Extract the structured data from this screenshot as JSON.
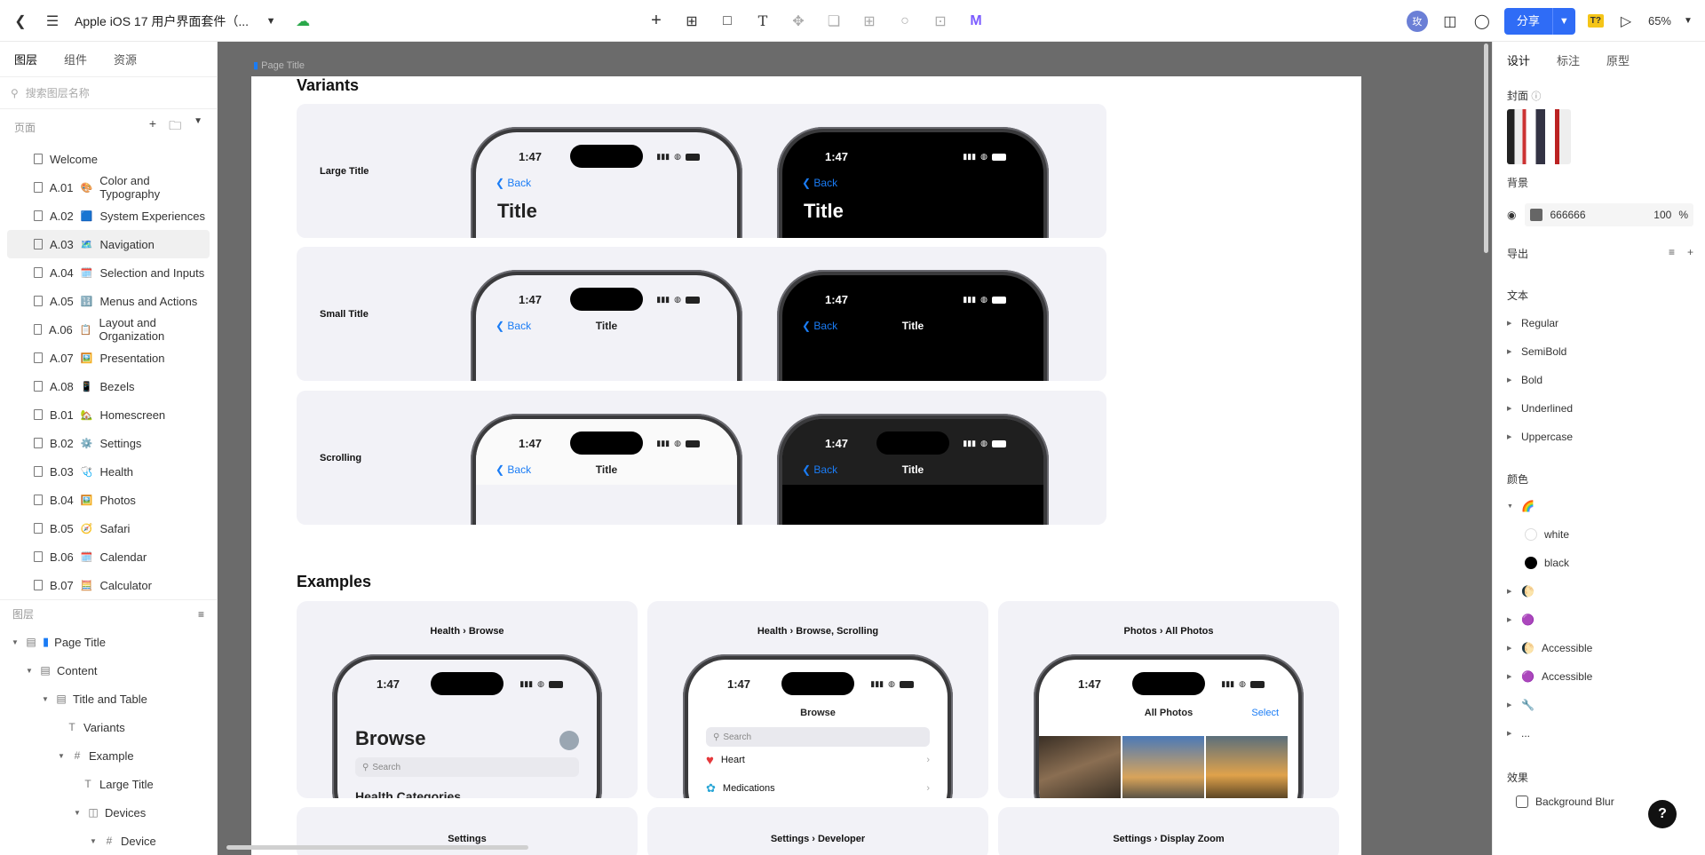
{
  "topbar": {
    "title": "Apple iOS 17 用户界面套件（...",
    "avatar": "玫",
    "share": "分享",
    "badge": "T?",
    "zoom": "65%"
  },
  "left": {
    "tabs": [
      "图层",
      "组件",
      "资源"
    ],
    "search_placeholder": "搜索图层名称",
    "pages_label": "页面",
    "pages": [
      {
        "label": "Welcome",
        "emoji": ""
      },
      {
        "label": "A.01",
        "emoji": "🎨",
        "name": "Color and Typography"
      },
      {
        "label": "A.02",
        "emoji": "🟦",
        "name": "System Experiences"
      },
      {
        "label": "A.03",
        "emoji": "🗺️",
        "name": "Navigation"
      },
      {
        "label": "A.04",
        "emoji": "🗓️",
        "name": "Selection and Inputs"
      },
      {
        "label": "A.05",
        "emoji": "🔢",
        "name": "Menus and Actions"
      },
      {
        "label": "A.06",
        "emoji": "📋",
        "name": "Layout and Organization"
      },
      {
        "label": "A.07",
        "emoji": "🖼️",
        "name": "Presentation"
      },
      {
        "label": "A.08",
        "emoji": "📱",
        "name": "Bezels"
      },
      {
        "label": "B.01",
        "emoji": "🏡",
        "name": "Homescreen"
      },
      {
        "label": "B.02",
        "emoji": "⚙️",
        "name": "Settings"
      },
      {
        "label": "B.03",
        "emoji": "🩺",
        "name": "Health"
      },
      {
        "label": "B.04",
        "emoji": "🖼️",
        "name": "Photos"
      },
      {
        "label": "B.05",
        "emoji": "🧭",
        "name": "Safari"
      },
      {
        "label": "B.06",
        "emoji": "🗓️",
        "name": "Calendar"
      },
      {
        "label": "B.07",
        "emoji": "🧮",
        "name": "Calculator"
      }
    ],
    "layers_label": "图层",
    "layers": [
      {
        "label": "Page Title"
      },
      {
        "label": "Content"
      },
      {
        "label": "Title and Table"
      },
      {
        "label": "Variants"
      },
      {
        "label": "Example"
      },
      {
        "label": "Large Title"
      },
      {
        "label": "Devices"
      },
      {
        "label": "Device"
      }
    ]
  },
  "canvas": {
    "page_title_label": "Page Title",
    "variants_heading": "Variants",
    "examples_heading": "Examples",
    "variants": [
      {
        "label": "Large Title",
        "time": "1:47",
        "back": "Back",
        "title": "Title"
      },
      {
        "label": "Small Title",
        "time": "1:47",
        "back": "Back",
        "title": "Title"
      },
      {
        "label": "Scrolling",
        "time": "1:47",
        "back": "Back",
        "title": "Title"
      }
    ],
    "examples": [
      {
        "caption": "Health › Browse",
        "time": "1:47",
        "title": "Browse",
        "search": "Search",
        "section": "Health Categories"
      },
      {
        "caption": "Health › Browse, Scrolling",
        "time": "1:47",
        "title": "Browse",
        "search": "Search",
        "row1": "Heart",
        "row2": "Medications"
      },
      {
        "caption": "Photos › All Photos",
        "time": "1:47",
        "title": "All Photos",
        "select": "Select"
      }
    ],
    "bottom_cards": [
      "Settings",
      "Settings › Developer",
      "Settings › Display Zoom"
    ]
  },
  "right": {
    "tabs": [
      "设计",
      "标注",
      "原型"
    ],
    "cover_label": "封面",
    "bg_label": "背景",
    "bg_hex": "666666",
    "bg_opacity": "100",
    "bg_pct": "%",
    "export_label": "导出",
    "text_label": "文本",
    "text_styles": [
      "Regular",
      "SemiBold",
      "Bold",
      "Underlined",
      "Uppercase"
    ],
    "color_label": "颜色",
    "colors": {
      "group1_emoji": "🌈",
      "white": "white",
      "black": "black",
      "g2_emoji": "🌔",
      "g3_emoji": "🟣",
      "accessible1": "Accessible",
      "accessible2": "Accessible",
      "g6_emoji": "🔧",
      "more": "..."
    },
    "effects_label": "效果",
    "blur": "Background Blur",
    "help": "?"
  }
}
